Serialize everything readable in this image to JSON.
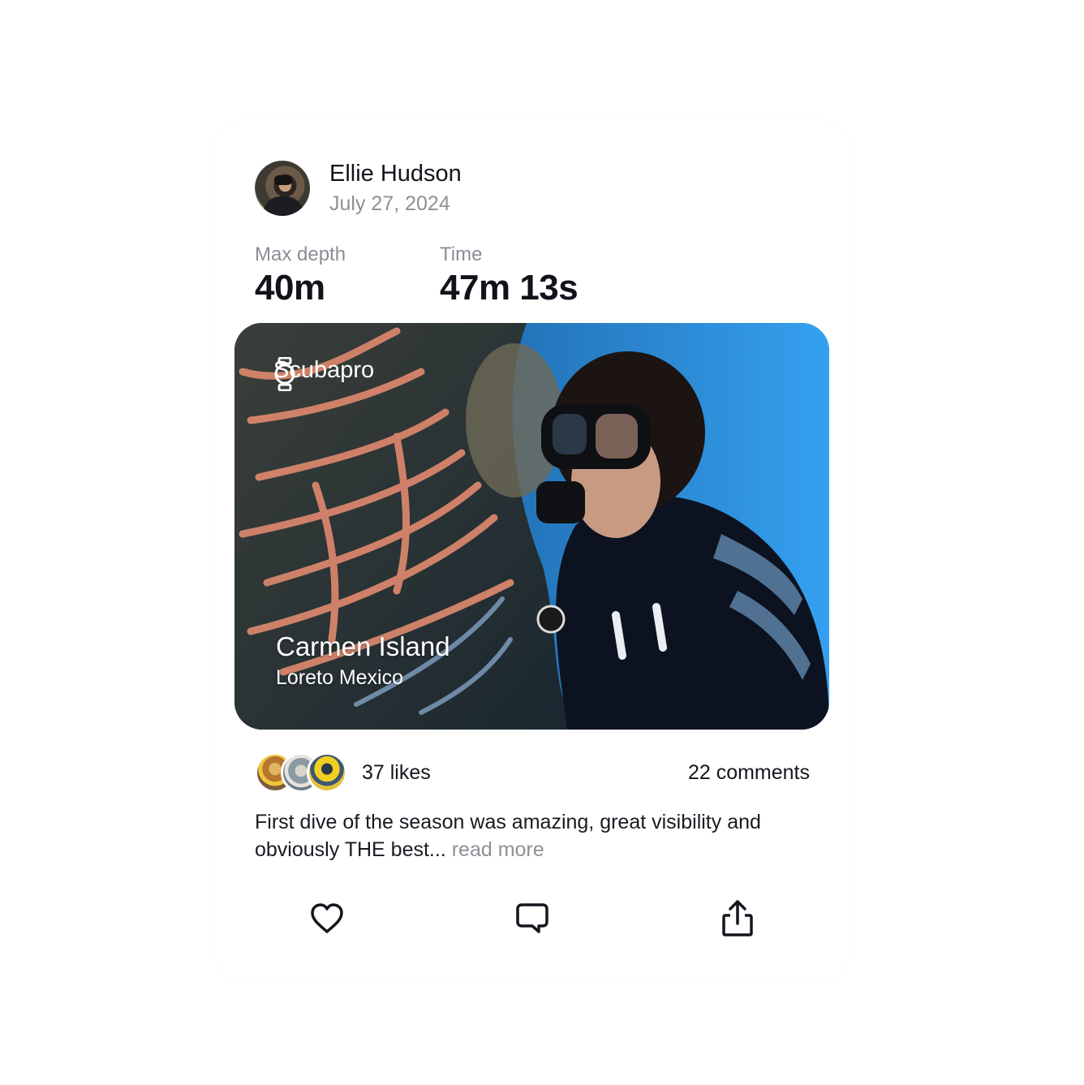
{
  "post": {
    "author": "Ellie Hudson",
    "date": "July 27, 2024",
    "stats": [
      {
        "label": "Max depth",
        "value": "40m"
      },
      {
        "label": "Time",
        "value": "47m 13s"
      }
    ],
    "photo": {
      "device": "Scubapro",
      "device_icon": "watch-icon",
      "location_title": "Carmen Island",
      "location_subtitle": "Loreto Mexico"
    },
    "likes": "37 likes",
    "comments": "22 comments",
    "caption": "First dive of the season was amazing, great visibility and obviously THE best...",
    "read_more": "read more",
    "actions": {
      "like_icon": "heart-icon",
      "comment_icon": "comment-icon",
      "share_icon": "share-icon"
    }
  },
  "colors": {
    "text_primary": "#14151c",
    "text_secondary": "#8e9096",
    "photo_accent": "#1f8ee8"
  }
}
